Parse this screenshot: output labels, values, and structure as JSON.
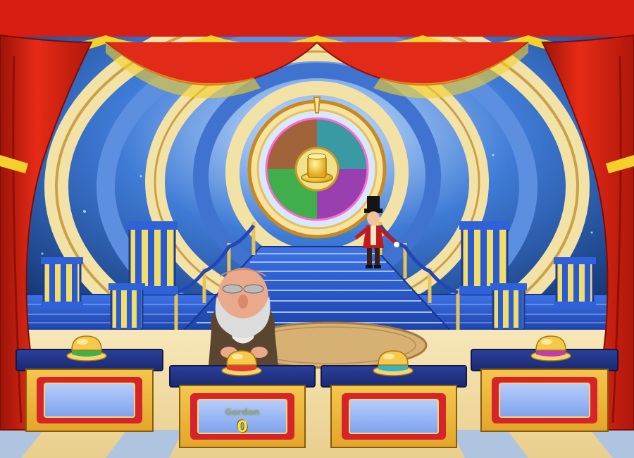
{
  "scene": "game-show-stage",
  "colors": {
    "curtain": "#d81e12",
    "curtain_trim": "#f4d02a",
    "sky": "#1b4fae",
    "stairs": "#2a5ad0",
    "podium_top": "#1a2a72",
    "podium_body": "#e3a62a",
    "screen": "#8fb0f2"
  },
  "wheel": {
    "segments": [
      {
        "color": "#a2623a"
      },
      {
        "color": "#3a9aa3"
      },
      {
        "color": "#3fae4b"
      },
      {
        "color": "#9a3fb0"
      }
    ],
    "center_icon": "gold-top-hat-icon"
  },
  "podiums": [
    {
      "player_name": "",
      "score": "",
      "buzzer_color": "#3fb04a"
    },
    {
      "player_name": "Gordon",
      "score": "0",
      "buzzer_color": "#e63b2e"
    },
    {
      "player_name": "",
      "score": "",
      "buzzer_color": "#35b3c9"
    },
    {
      "player_name": "",
      "score": "",
      "buzzer_color": "#c23bb0"
    }
  ]
}
